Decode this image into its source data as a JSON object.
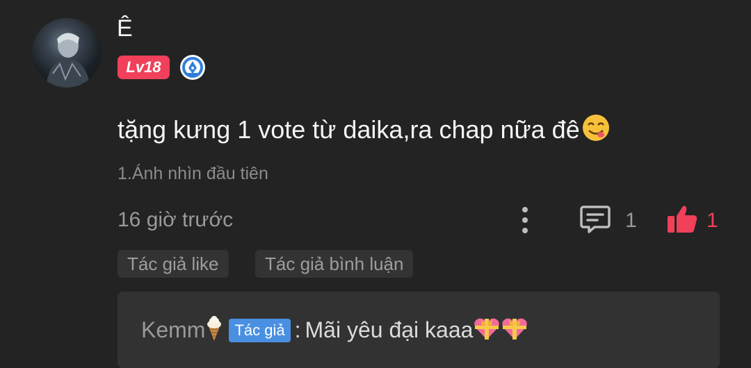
{
  "comment": {
    "user": {
      "name": "Ê",
      "level_badge": "Lv18",
      "avatar": "avatar-photo",
      "rank_icon": "pen-nib-badge-icon"
    },
    "text": "tặng kưng 1 vote từ daika,ra chap nữa đê",
    "text_emoji": "yum-face-icon",
    "chapter_ref": "1.Ánh nhìn đầu tiên",
    "timestamp": "16 giờ trước",
    "actions": {
      "more_icon": "more-vertical-icon",
      "reply_icon": "comment-icon",
      "reply_count": "1",
      "like_icon": "thumbs-up-icon",
      "like_count": "1"
    },
    "tags": [
      "Tác giả like",
      "Tác giả bình luận"
    ]
  },
  "reply": {
    "author": "Kemm",
    "author_icon": "ice-cream-icon",
    "author_badge": "Tác giả",
    "colon": ":",
    "text": "Mãi yêu đại kaaa",
    "trailing_icons": [
      "gift-heart-icon",
      "gift-heart-icon"
    ]
  },
  "colors": {
    "background": "#232323",
    "like_accent": "#f0405a",
    "author_badge": "#4a90e2",
    "tag_background": "#333333"
  }
}
